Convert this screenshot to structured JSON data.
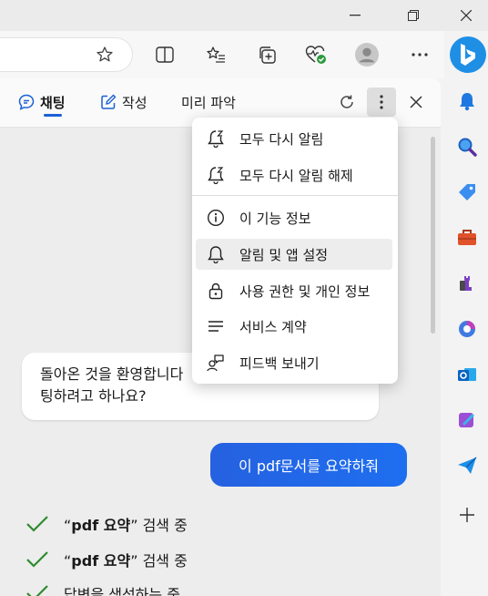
{
  "panel": {
    "tabs": [
      {
        "label": "채팅"
      },
      {
        "label": "작성"
      },
      {
        "label": "미리 파악"
      }
    ]
  },
  "menu": {
    "items": [
      {
        "label": "모두 다시 알림",
        "icon": "bell-snooze-icon"
      },
      {
        "label": "모두 다시 알림 해제",
        "icon": "bell-snooze-icon"
      },
      {
        "label": "이 기능 정보",
        "icon": "info-icon"
      },
      {
        "label": "알림 및 앱 설정",
        "icon": "bell-icon"
      },
      {
        "label": "사용 권한 및 개인 정보",
        "icon": "lock-icon"
      },
      {
        "label": "서비스 계약",
        "icon": "list-icon"
      },
      {
        "label": "피드백 보내기",
        "icon": "feedback-icon"
      }
    ]
  },
  "chat": {
    "incoming_line1": "돌아온 것을 환영합니다",
    "incoming_line2": "팅하려고 하나요?",
    "outgoing": "이 pdf문서를 요약하줘",
    "status": [
      {
        "quote_open": "“",
        "keyword": "pdf 요약",
        "quote_close": "”",
        "suffix": " 검색 중"
      },
      {
        "quote_open": "“",
        "keyword": "pdf 요약",
        "quote_close": "”",
        "suffix": " 검색 중"
      },
      {
        "text": "답변을 생성하는 중..."
      }
    ]
  },
  "colors": {
    "accent": "#1a61d6",
    "check": "#2e8b2e"
  }
}
